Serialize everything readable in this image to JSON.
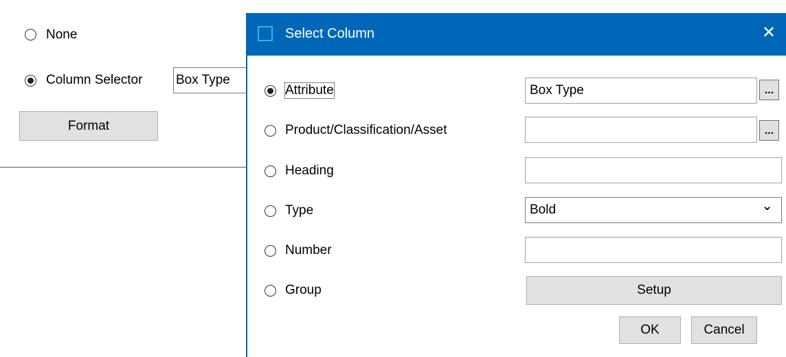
{
  "background_form": {
    "none_label": "None",
    "column_selector_label": "Column Selector",
    "column_value": "Box Type",
    "format_button": "Format"
  },
  "dialog": {
    "title": "Select Column",
    "close_symbol": "✕",
    "accent_color": "#0067b8",
    "options": {
      "attribute": "Attribute",
      "product": "Product/Classification/Asset",
      "heading": "Heading",
      "type": "Type",
      "number": "Number",
      "group": "Group"
    },
    "fields": {
      "attribute_value": "Box Type",
      "product_value": "",
      "heading_value": "",
      "type_value": "Bold",
      "number_value": ""
    },
    "browse_label": "...",
    "dropdown_arrow": "⌄",
    "setup_button": "Setup",
    "ok_button": "OK",
    "cancel_button": "Cancel"
  }
}
